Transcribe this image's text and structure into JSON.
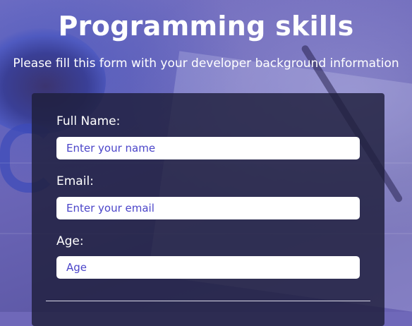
{
  "header": {
    "title": "Programming skills",
    "subtitle": "Please fill this form with your developer background information"
  },
  "form": {
    "fields": [
      {
        "label": "Full Name:",
        "placeholder": "Enter your name",
        "value": ""
      },
      {
        "label": "Email:",
        "placeholder": "Enter your email",
        "value": ""
      },
      {
        "label": "Age:",
        "placeholder": "Age",
        "value": ""
      }
    ]
  },
  "colors": {
    "background_overlay": "#6f68b9",
    "form_background": "#1e1e3c",
    "placeholder_text": "#4b45c9",
    "text": "#ffffff"
  }
}
